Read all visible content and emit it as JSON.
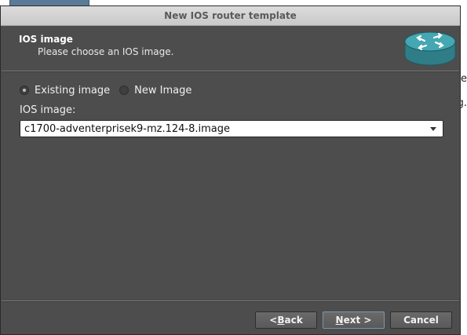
{
  "dialog": {
    "title": "New IOS router template"
  },
  "header": {
    "title": "IOS image",
    "subtitle": "Please choose an IOS image.",
    "icon": "router-icon"
  },
  "image_source": {
    "options": [
      {
        "label": "Existing image",
        "checked": true
      },
      {
        "label": "New Image",
        "checked": false
      }
    ]
  },
  "ios_image": {
    "label": "IOS image:",
    "selected": "c1700-adventerprisek9-mz.124-8.image"
  },
  "buttons": {
    "back": {
      "prefix": "< ",
      "mnemonic": "B",
      "rest": "ack"
    },
    "next": {
      "mnemonic": "N",
      "rest": "ext >"
    },
    "cancel": "Cancel"
  },
  "background_fragments": [
    "se",
    "g."
  ],
  "colors": {
    "dialog_bg": "#4d4d4d",
    "router_icon": "#3f9ba6"
  }
}
